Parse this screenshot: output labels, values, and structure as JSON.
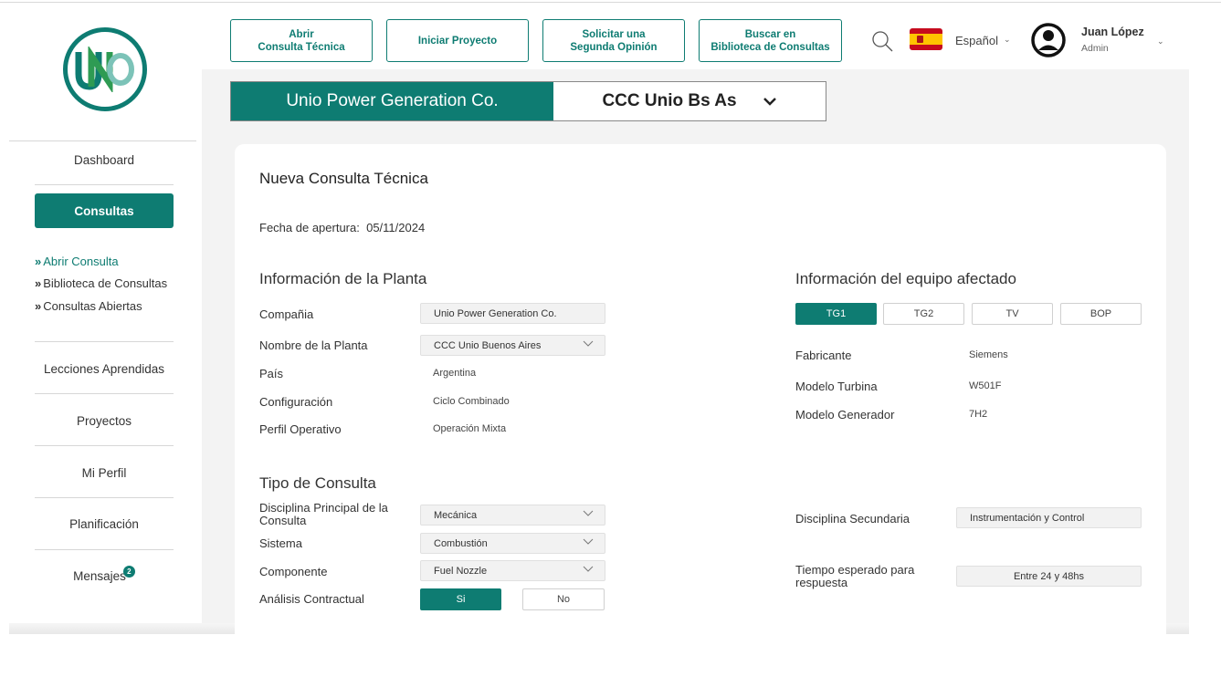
{
  "header": {
    "buttons": [
      {
        "label": "Abrir\nConsulta Técnica"
      },
      {
        "label": "Iniciar Proyecto"
      },
      {
        "label": "Solicitar una\nSegunda Opinión"
      },
      {
        "label": "Buscar en\nBiblioteca de Consultas"
      }
    ],
    "language": "Español",
    "user_name": "Juan López",
    "user_role": "Admin",
    "icons": [
      "search-icon",
      "spain-flag-icon",
      "user-avatar-icon",
      "chevron-down-icon"
    ]
  },
  "sidebar": {
    "logo_text": "UNIO",
    "items": [
      {
        "label": "Dashboard"
      },
      {
        "label": "Consultas"
      },
      {
        "label": "Lecciones Aprendidas"
      },
      {
        "label": "Proyectos"
      },
      {
        "label": "Mi Perfil"
      },
      {
        "label": "Planificación"
      },
      {
        "label": "Mensajes",
        "badge": "2"
      }
    ],
    "sub_items": [
      {
        "label": "Abrir Consulta"
      },
      {
        "label": "Biblioteca de Consultas"
      },
      {
        "label": "Consultas Abiertas"
      }
    ]
  },
  "company_selector": {
    "company": "Unio Power Generation Co.",
    "plant": "CCC Unio Bs As"
  },
  "form": {
    "title": "Nueva Consulta Técnica",
    "opening_label": "Fecha de apertura:",
    "opening_date": "05/11/2024",
    "plant_section": {
      "title": "Información de la Planta",
      "company_label": "Compañia",
      "company_value": "Unio Power Generation Co.",
      "plant_label": "Nombre de la Planta",
      "plant_value": "CCC Unio Buenos Aires",
      "country_label": "País",
      "country_value": "Argentina",
      "config_label": "Configuración",
      "config_value": "Ciclo Combinado",
      "profile_label": "Perfil Operativo",
      "profile_value": "Operación Mixta"
    },
    "equipment_section": {
      "title": "Información del equipo afectado",
      "tabs": [
        "TG1",
        "TG2",
        "TV",
        "BOP"
      ],
      "selected_tab": "TG1",
      "maker_label": "Fabricante",
      "maker_value": "Siemens",
      "turbine_label": "Modelo Turbina",
      "turbine_value": "W501F",
      "generator_label": "Modelo Generador",
      "generator_value": "7H2"
    },
    "type_section": {
      "title": "Tipo de Consulta",
      "main_discipline_label": "Disciplina Principal de la Consulta",
      "main_discipline_value": "Mecánica",
      "system_label": "Sistema",
      "system_value": "Combustión",
      "component_label": "Componente",
      "component_value": "Fuel Nozzle",
      "contract_label": "Análisis Contractual",
      "contract_yes": "Si",
      "contract_no": "No",
      "secondary_label": "Disciplina Secundaria",
      "secondary_value": "Instrumentación y Control",
      "response_label": "Tiempo esperado para respuesta",
      "response_value": "Entre 24 y 48hs"
    }
  },
  "colors": {
    "accent": "#0e7c72",
    "flag_red": "#c60b1e",
    "flag_yellow": "#ffc400",
    "background": "#f3f3f3"
  }
}
